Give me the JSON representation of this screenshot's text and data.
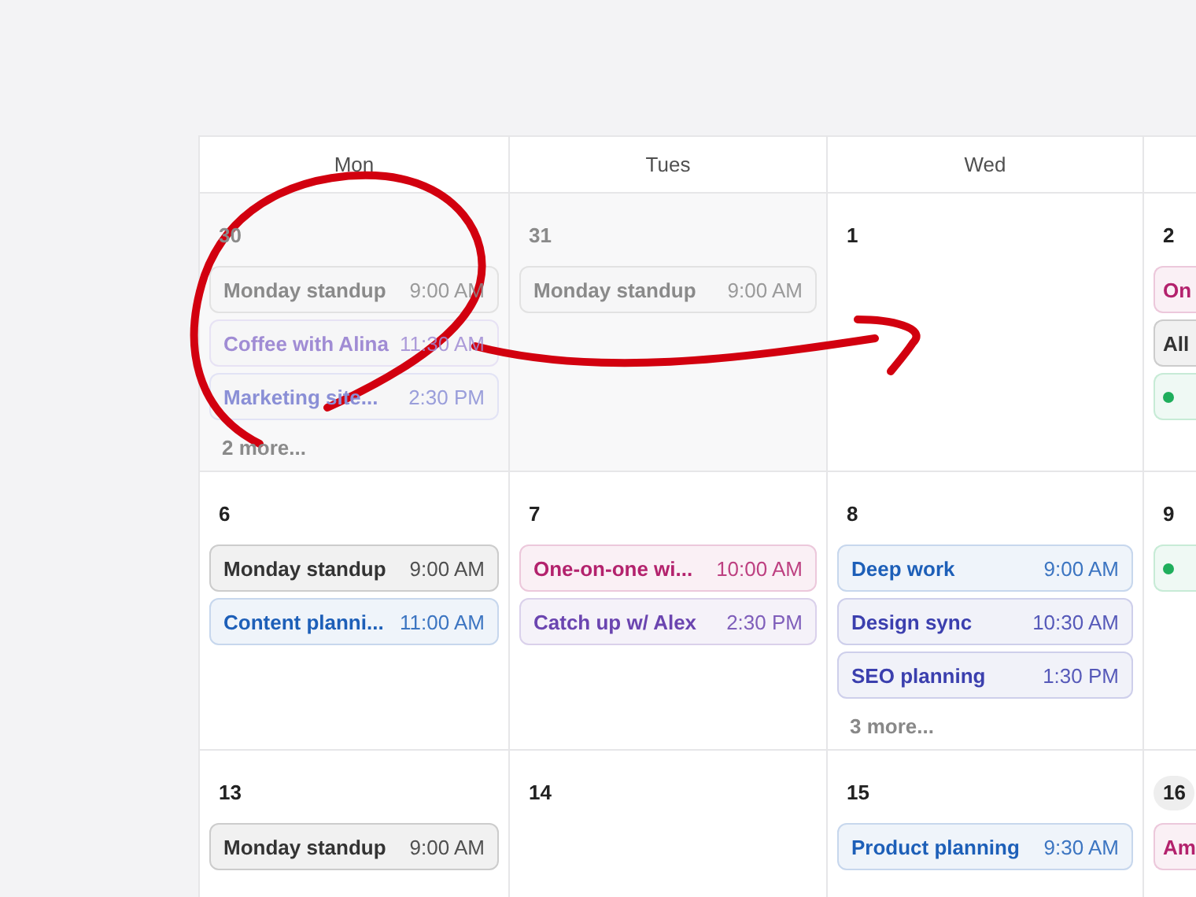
{
  "calendar": {
    "columns": [
      "Mon",
      "Tues",
      "Wed"
    ],
    "weeks": [
      {
        "days": [
          {
            "date": "30",
            "outside_month": true,
            "today": false,
            "events": [
              {
                "title": "Monday standup",
                "time": "9:00 AM",
                "color": "#8a8a8a"
              },
              {
                "title": "Coffee with Alina",
                "time": "11:30 AM",
                "color": "#a08cd4"
              },
              {
                "title": "Marketing site...",
                "time": "2:30 PM",
                "color": "#8a8fd6"
              }
            ],
            "more": "2 more..."
          },
          {
            "date": "31",
            "outside_month": true,
            "today": false,
            "events": [
              {
                "title": "Monday standup",
                "time": "9:00 AM",
                "color": "#8a8a8a"
              }
            ]
          },
          {
            "date": "1",
            "outside_month": false,
            "today": false
          },
          {
            "date": "2",
            "outside_month": false,
            "today": false,
            "events": [
              {
                "title": "On",
                "color": "#b3226d"
              },
              {
                "title": "All",
                "color": "#333333"
              },
              {
                "kind": "dot",
                "color": "#1fae5c"
              }
            ]
          }
        ]
      },
      {
        "days": [
          {
            "date": "6",
            "outside_month": false,
            "today": false,
            "events": [
              {
                "title": "Monday standup",
                "time": "9:00 AM",
                "color": "#333333"
              },
              {
                "title": "Content planni...",
                "time": "11:00 AM",
                "color": "#1d5fb8"
              }
            ]
          },
          {
            "date": "7",
            "outside_month": false,
            "today": false,
            "events": [
              {
                "title": "One-on-one wi...",
                "time": "10:00 AM",
                "color": "#b3226d"
              },
              {
                "title": "Catch up w/ Alex",
                "time": "2:30 PM",
                "color": "#6b45b0"
              }
            ]
          },
          {
            "date": "8",
            "outside_month": false,
            "today": false,
            "events": [
              {
                "title": "Deep work",
                "time": "9:00 AM",
                "color": "#1d5fb8"
              },
              {
                "title": "Design sync",
                "time": "10:30 AM",
                "color": "#3b3fae"
              },
              {
                "title": "SEO planning",
                "time": "1:30 PM",
                "color": "#3b3fae"
              }
            ],
            "more": "3 more..."
          },
          {
            "date": "9",
            "outside_month": false,
            "today": false,
            "events": [
              {
                "kind": "dot",
                "color": "#1fae5c"
              }
            ]
          }
        ]
      },
      {
        "days": [
          {
            "date": "13",
            "outside_month": false,
            "today": false,
            "events": [
              {
                "title": "Monday standup",
                "time": "9:00 AM",
                "color": "#333333"
              }
            ]
          },
          {
            "date": "14",
            "outside_month": false,
            "today": false
          },
          {
            "date": "15",
            "outside_month": false,
            "today": false,
            "events": [
              {
                "title": "Product planning",
                "time": "9:30 AM",
                "color": "#1d5fb8"
              }
            ]
          },
          {
            "date": "16",
            "outside_month": false,
            "today": true,
            "events": [
              {
                "title": "Am",
                "color": "#b3226d"
              }
            ]
          }
        ]
      }
    ]
  }
}
